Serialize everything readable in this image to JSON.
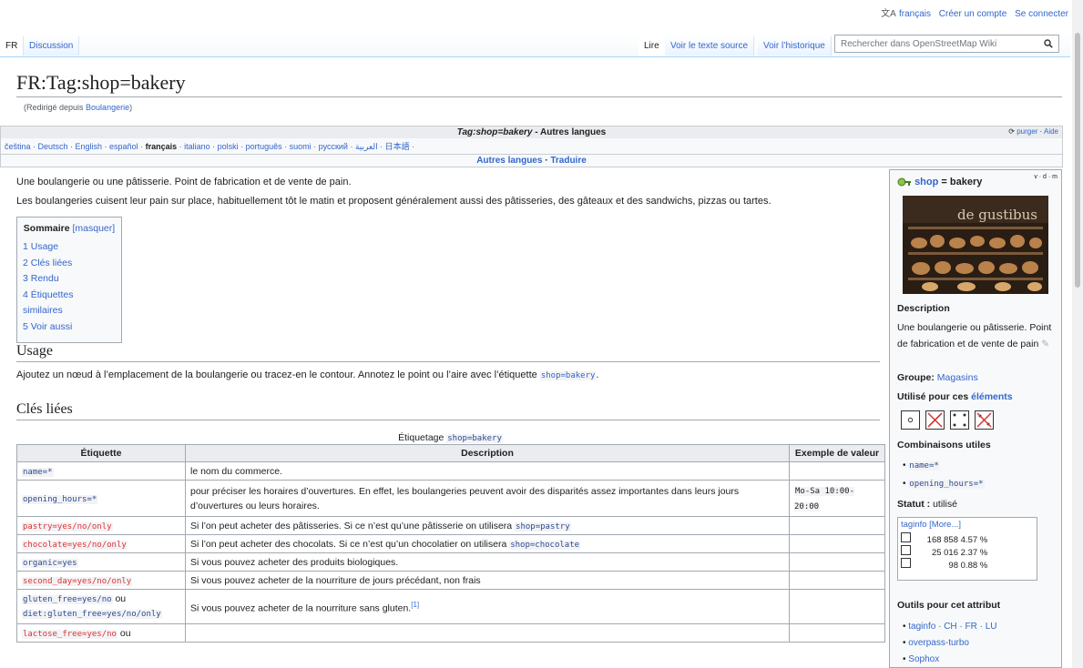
{
  "personal": {
    "lang": "français",
    "create": "Créer un compte",
    "login": "Se connecter"
  },
  "tabs": {
    "ns": "FR",
    "discussion": "Discussion",
    "read": "Lire",
    "source": "Voir le texte source",
    "history": "Voir l’historique"
  },
  "search": {
    "placeholder": "Rechercher dans OpenStreetMap Wiki"
  },
  "page": {
    "title": "FR:Tag:shop=bakery",
    "redirect_prefix": "(Redirigé depuis ",
    "redirect_link": "Boulangerie",
    "redirect_suffix": ")"
  },
  "langs": {
    "title_tag": "Tag:shop=bakery",
    "title_rest": " - Autres langues",
    "purge": "purger",
    "help": "Aide",
    "list_a": "čeština · Deutsch · English · español · ",
    "current": "français",
    "list_b": " · italiano · polski · português · suomi · русский · العربية · 日本語 ·",
    "other": "Autres langues",
    "translate": "Traduire"
  },
  "intro": {
    "p1": "Une boulangerie ou une pâtisserie. Point de fabrication et de vente de pain.",
    "p2": "Les boulangeries cuisent leur pain sur place, habituellement tôt le matin et proposent généralement aussi des pâtisseries, des gâteaux et des sandwichs, pizzas ou tartes."
  },
  "toc": {
    "title": "Sommaire",
    "toggle": "[masquer]",
    "items": [
      "1 Usage",
      "2 Clés liées",
      "3 Rendu",
      "4 Étiquettes similaires",
      "5 Voir aussi"
    ]
  },
  "usage": {
    "heading": "Usage",
    "text": "Ajoutez un nœud à l’emplacement de la boulangerie ou tracez-en le contour. Annotez le point ou l’aire avec l’étiquette ",
    "tag": "shop=bakery",
    "end": "."
  },
  "cles": {
    "heading": "Clés liées",
    "caption_pre": "Étiquetage ",
    "caption_tag": "shop=bakery",
    "headers": [
      "Étiquette",
      "Description",
      "Exemple de valeur"
    ],
    "rows": [
      {
        "tag": "name=*",
        "desc": "le nom du commerce.",
        "desc_tag": "",
        "example": ""
      },
      {
        "tag": "opening_hours=*",
        "desc": "pour préciser les horaires d’ouvertures. En effet, les boulangeries peuvent avoir des disparités assez importantes dans leurs jours d’ouvertures ou leurs horaires.",
        "desc_tag": "",
        "example": "Mo-Sa 10:00-20:00"
      },
      {
        "tag": "pastry=yes/no/only",
        "desc": "Si l’on peut acheter des pâtisseries. Si ce n’est qu’une pâtisserie on utilisera ",
        "desc_tag": "shop=pastry",
        "example": ""
      },
      {
        "tag": "chocolate=yes/no/only",
        "desc": "Si l’on peut acheter des chocolats. Si ce n’est qu’un chocolatier on utilisera ",
        "desc_tag": "shop=chocolate",
        "example": ""
      },
      {
        "tag": "organic=yes",
        "desc": "Si vous pouvez acheter des produits biologiques.",
        "desc_tag": "",
        "example": ""
      },
      {
        "tag": "second_day=yes/no/only",
        "desc": "Si vous pouvez acheter de la nourriture de jours précédant, non frais",
        "desc_tag": "",
        "example": ""
      },
      {
        "tag": "gluten_free=yes/no",
        "tag_or": " ou",
        "tag2": "diet:gluten_free=yes/no/only",
        "desc": "Si vous pouvez acheter de la nourriture sans gluten.",
        "desc_tag": "",
        "ref": "[1]",
        "example": ""
      },
      {
        "tag": "lactose_free=yes/no",
        "tag_or": " ou",
        "desc": "",
        "desc_tag": "",
        "example": ""
      }
    ]
  },
  "infobox": {
    "key": "shop",
    "value": "= bakery",
    "vdm": "v · d · m",
    "photo_text": "de gustibus",
    "desc_heading": "Description",
    "desc": "Une boulangerie ou pâtisserie. Point de fabrication et de vente de pain",
    "group_label": "Groupe:",
    "group_value": "Magasins",
    "used_label": "Utilisé pour ces ",
    "used_link": "éléments",
    "combos_heading": "Combinaisons utiles",
    "combos": [
      "name=*",
      "opening_hours=*"
    ],
    "status_label": "Statut :",
    "status_value": "utilisé",
    "taginfo_title": "taginfo",
    "taginfo_more": "[More...]",
    "taginfo_rows": [
      {
        "count": "168 858",
        "pct": "4.57 %"
      },
      {
        "count": "25 016",
        "pct": "2.37 %"
      },
      {
        "count": "98",
        "pct": "0.88 %"
      }
    ],
    "tools_heading": "Outils pour cet attribut",
    "tools": [
      "taginfo · CH · FR · LU",
      "overpass-turbo",
      "Sophox"
    ]
  }
}
